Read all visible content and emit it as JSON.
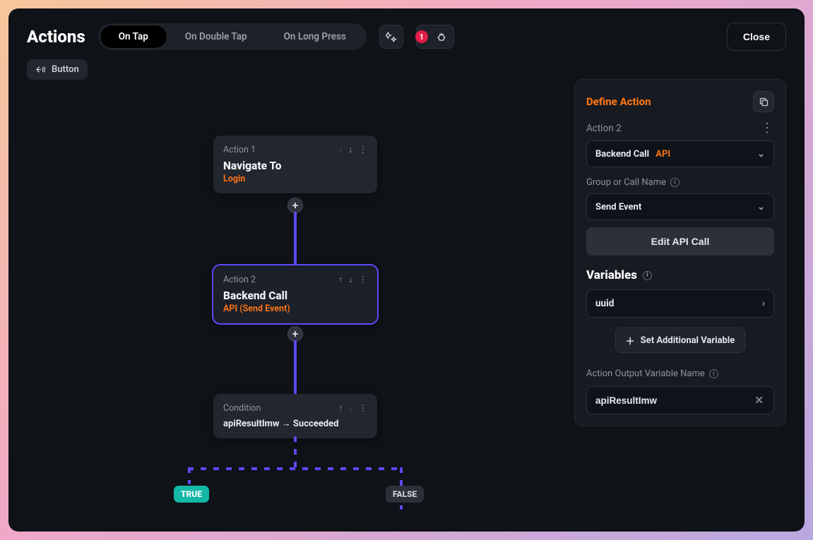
{
  "header": {
    "title": "Actions",
    "tabs": [
      "On Tap",
      "On Double Tap",
      "On Long Press"
    ],
    "active_tab": 0,
    "bug_count": "1",
    "close_label": "Close"
  },
  "chip": {
    "label": "Button"
  },
  "flow": {
    "node1": {
      "label": "Action 1",
      "title": "Navigate To",
      "sub": "Login"
    },
    "node2": {
      "label": "Action 2",
      "title": "Backend Call",
      "sub": "API (Send Event)"
    },
    "node3": {
      "label": "Condition",
      "text": "apiResultImw → Succeeded"
    },
    "true_label": "TRUE",
    "false_label": "FALSE"
  },
  "panel": {
    "heading": "Define Action",
    "action_label": "Action 2",
    "type_main": "Backend Call",
    "type_sub": "API",
    "group_label": "Group or Call Name",
    "group_value": "Send Event",
    "edit_btn": "Edit API Call",
    "vars_heading": "Variables",
    "var1": "uuid",
    "add_var_btn": "Set Additional Variable",
    "output_label": "Action Output Variable Name",
    "output_value": "apiResultImw"
  }
}
